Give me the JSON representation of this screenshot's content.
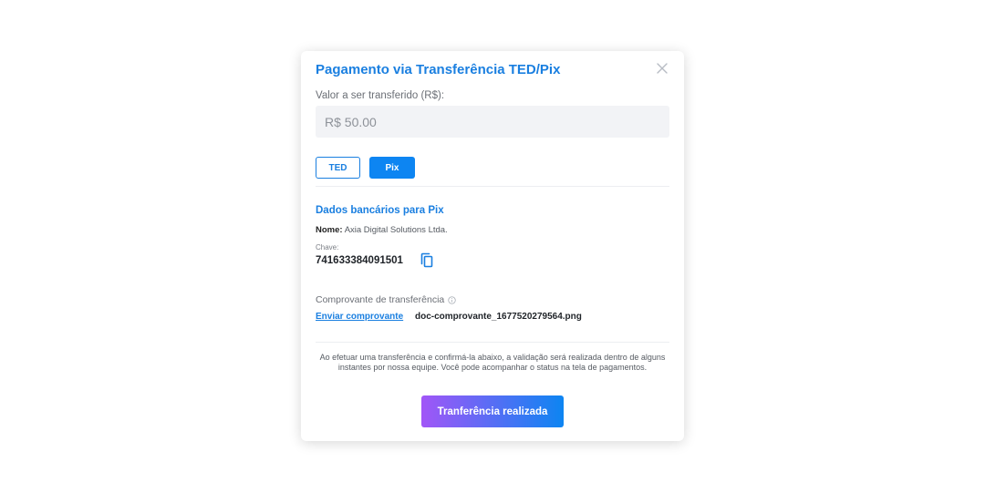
{
  "modal": {
    "title": "Pagamento via Transferência TED/Pix",
    "close_icon": "close-icon"
  },
  "amount": {
    "label": "Valor a ser transferido (R$):",
    "value": "R$ 50.00"
  },
  "methods": {
    "ted_label": "TED",
    "pix_label": "Pix",
    "selected": "Pix"
  },
  "bank_details": {
    "title": "Dados bancários para Pix",
    "name_label": "Nome:",
    "name_value": "Axia Digital Solutions Ltda.",
    "key_label": "Chave:",
    "key_value": "741633384091501",
    "copy_icon": "copy-icon"
  },
  "receipt": {
    "label": "Comprovante de transferência",
    "info_icon": "info-icon",
    "upload_link": "Enviar comprovante",
    "file_name": "doc-comprovante_1677520279564.png"
  },
  "notice": "Ao efetuar uma transferência e confirmá-la abaixo, a validação será realizada dentro de alguns instantes por nossa equipe. Você pode acompanhar o status na tela de pagamentos.",
  "submit_label": "Tranferência realizada",
  "colors": {
    "accent": "#1a7fe0",
    "pix_button": "#0d85f2",
    "gradient_start": "#a156f7",
    "gradient_end": "#0d85f2"
  }
}
